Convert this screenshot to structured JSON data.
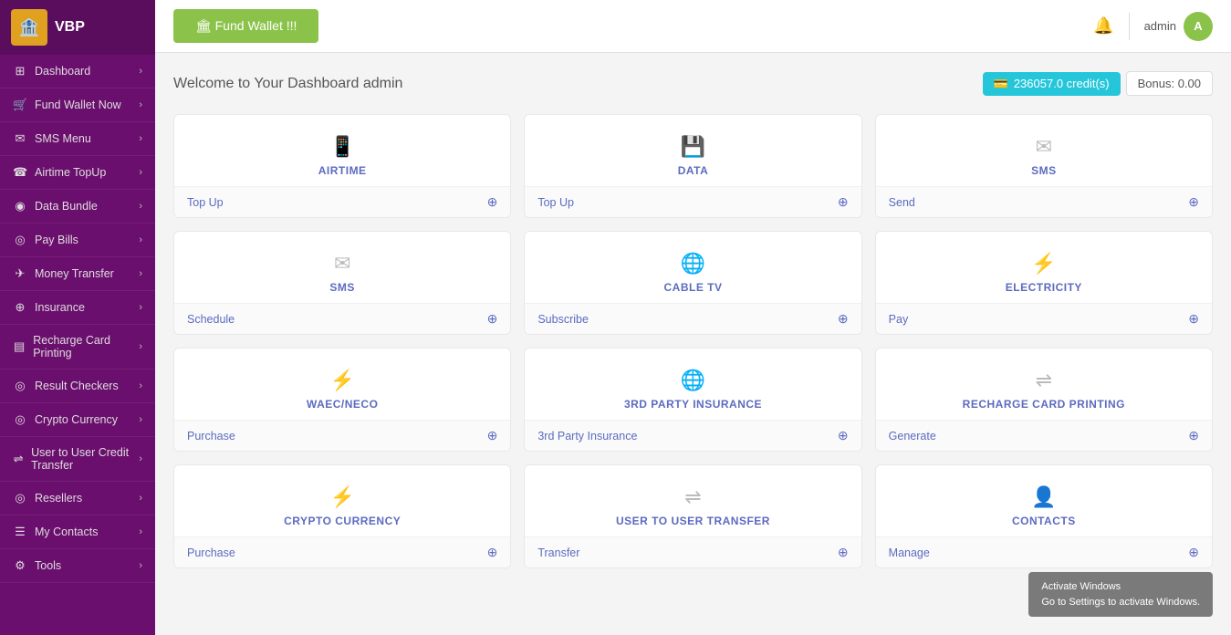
{
  "sidebar": {
    "logo": {
      "text": "VBP",
      "icon": "🏦"
    },
    "items": [
      {
        "id": "dashboard",
        "icon": "⊞",
        "label": "Dashboard",
        "hasChevron": true
      },
      {
        "id": "fund-wallet",
        "icon": "🛒",
        "label": "Fund Wallet Now",
        "hasChevron": true
      },
      {
        "id": "sms-menu",
        "icon": "✉",
        "label": "SMS Menu",
        "hasChevron": true
      },
      {
        "id": "airtime-topup",
        "icon": "☎",
        "label": "Airtime TopUp",
        "hasChevron": true
      },
      {
        "id": "data-bundle",
        "icon": "◉",
        "label": "Data Bundle",
        "hasChevron": true
      },
      {
        "id": "pay-bills",
        "icon": "◎",
        "label": "Pay Bills",
        "hasChevron": true
      },
      {
        "id": "money-transfer",
        "icon": "✈",
        "label": "Money Transfer",
        "hasChevron": true
      },
      {
        "id": "insurance",
        "icon": "⊕",
        "label": "Insurance",
        "hasChevron": true
      },
      {
        "id": "recharge-card",
        "icon": "▤",
        "label": "Recharge Card Printing",
        "hasChevron": true
      },
      {
        "id": "result-checkers",
        "icon": "◎",
        "label": "Result Checkers",
        "hasChevron": true
      },
      {
        "id": "crypto-currency",
        "icon": "◎",
        "label": "Crypto Currency",
        "hasChevron": true
      },
      {
        "id": "user-transfer",
        "icon": "⇌",
        "label": "User to User Credit Transfer",
        "hasChevron": true
      },
      {
        "id": "resellers",
        "icon": "◎",
        "label": "Resellers",
        "hasChevron": true
      },
      {
        "id": "my-contacts",
        "icon": "☰",
        "label": "My Contacts",
        "hasChevron": true
      },
      {
        "id": "tools",
        "icon": "⚙",
        "label": "Tools",
        "hasChevron": true
      }
    ]
  },
  "topbar": {
    "fund_wallet_label": "🏛 Fund Wallet !!!",
    "bell_icon": "🔔",
    "admin_label": "admin"
  },
  "dashboard": {
    "welcome_text": "Welcome to Your Dashboard admin",
    "credits": "236057.0 credit(s)",
    "bonus": "Bonus: 0.00",
    "cards": [
      {
        "id": "airtime",
        "icon": "📱",
        "title": "AIRTIME",
        "action": "Top Up"
      },
      {
        "id": "data",
        "icon": "💾",
        "title": "DATA",
        "action": "Top Up"
      },
      {
        "id": "sms",
        "icon": "✉",
        "title": "SMS",
        "action": "Send"
      },
      {
        "id": "sms2",
        "icon": "✉",
        "title": "SMS",
        "action": "Schedule"
      },
      {
        "id": "cable-tv",
        "icon": "🌐",
        "title": "CABLE TV",
        "action": "Subscribe"
      },
      {
        "id": "electricity",
        "icon": "⚡",
        "title": "ELECTRICITY",
        "action": "Pay"
      },
      {
        "id": "waec",
        "icon": "⚡",
        "title": "WAEC/NECO",
        "action": "Purchase"
      },
      {
        "id": "3rd-party",
        "icon": "🌐",
        "title": "3RD PARTY INSURANCE",
        "action": "3rd Party Insurance"
      },
      {
        "id": "recharge-card",
        "icon": "⇌",
        "title": "RECHARGE CARD PRINTING",
        "action": "Generate"
      },
      {
        "id": "crypto",
        "icon": "⚡",
        "title": "CRYPTO CURRENCY",
        "action": "Purchase"
      },
      {
        "id": "user-transfer",
        "icon": "⇌",
        "title": "USER TO USER TRANSFER",
        "action": "Transfer"
      },
      {
        "id": "contacts",
        "icon": "👤",
        "title": "CONTACTS",
        "action": "Manage"
      }
    ]
  },
  "windows": {
    "line1": "Activate Windows",
    "line2": "Go to Settings to activate Windows."
  }
}
